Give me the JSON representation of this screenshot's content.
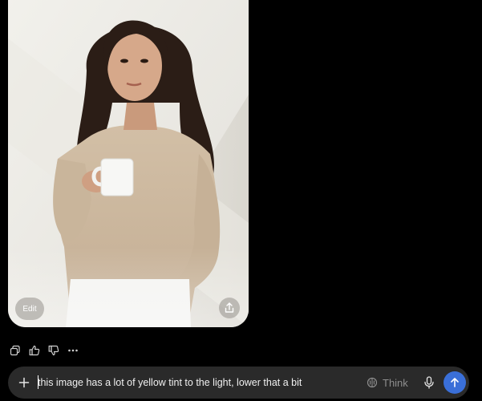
{
  "image_card": {
    "edit_label": "Edit",
    "share_icon": "share-icon"
  },
  "actions": {
    "icons": [
      "copy-icon",
      "thumbs-up-icon",
      "thumbs-down-icon",
      "more-icon"
    ]
  },
  "composer": {
    "input_value": "this image has a lot of yellow tint to the light, lower that a bit",
    "think_label": "Think",
    "send_color": "#3a6fd8"
  }
}
